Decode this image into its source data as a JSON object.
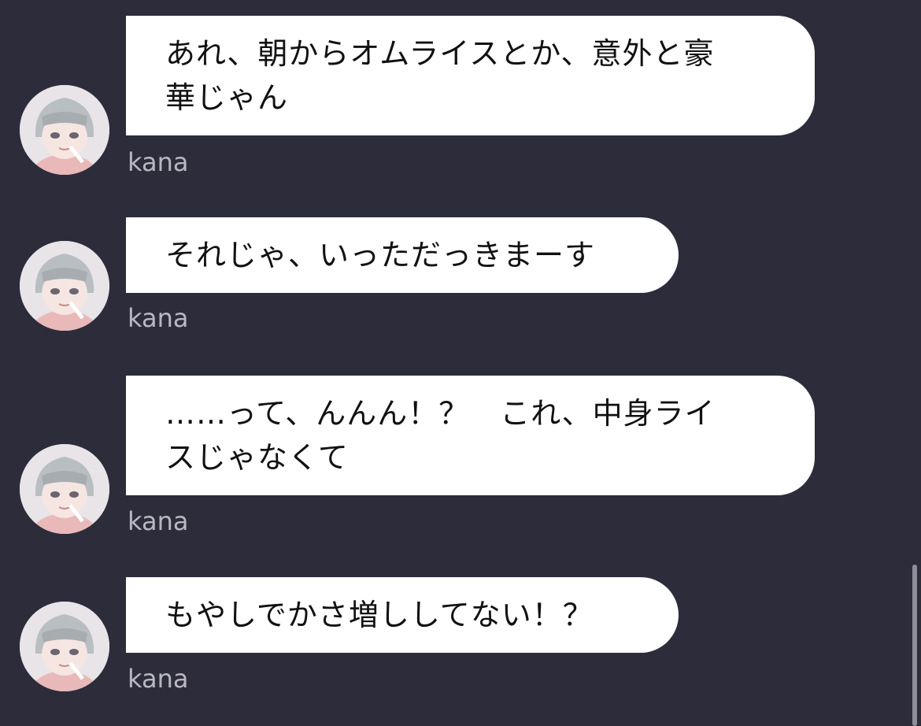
{
  "messages": [
    {
      "sender": "kana",
      "text": "あれ、朝からオムライスとか、意外と豪\n華じゃん"
    },
    {
      "sender": "kana",
      "text": "それじゃ、いっただっきまーす"
    },
    {
      "sender": "kana",
      "text": "……って、んんん！？　これ、中身ライ\nスじゃなくて"
    },
    {
      "sender": "kana",
      "text": "もやしでかさ増ししてない！？"
    }
  ],
  "colors": {
    "background": "#2d2c3b",
    "bubble": "#ffffff",
    "sender_text": "#b9b8c2"
  },
  "icons": {
    "avatar": "girl-portrait-avatar"
  }
}
